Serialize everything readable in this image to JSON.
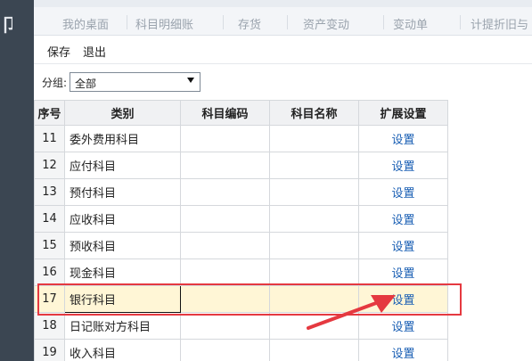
{
  "sidebar": {
    "glyph": "卩"
  },
  "tabs": [
    "我的桌面",
    "科目明细账",
    "存货",
    "资产变动",
    "变动单",
    "计提折旧与"
  ],
  "toolbar": {
    "save": "保存",
    "exit": "退出"
  },
  "filter": {
    "label": "分组:",
    "selected": "全部"
  },
  "table": {
    "headers": [
      "序号",
      "类别",
      "科目编码",
      "科目名称",
      "扩展设置"
    ],
    "rows": [
      {
        "idx": "11",
        "category": "委外费用科目",
        "code": "",
        "name": "",
        "action": "设置"
      },
      {
        "idx": "12",
        "category": "应付科目",
        "code": "",
        "name": "",
        "action": "设置"
      },
      {
        "idx": "13",
        "category": "预付科目",
        "code": "",
        "name": "",
        "action": "设置"
      },
      {
        "idx": "14",
        "category": "应收科目",
        "code": "",
        "name": "",
        "action": "设置"
      },
      {
        "idx": "15",
        "category": "预收科目",
        "code": "",
        "name": "",
        "action": "设置"
      },
      {
        "idx": "16",
        "category": "现金科目",
        "code": "",
        "name": "",
        "action": "设置"
      },
      {
        "idx": "17",
        "category": "银行科目",
        "code": "",
        "name": "",
        "action": "设置"
      },
      {
        "idx": "18",
        "category": "日记账对方科目",
        "code": "",
        "name": "",
        "action": "设置"
      },
      {
        "idx": "19",
        "category": "收入科目",
        "code": "",
        "name": "",
        "action": "设置"
      }
    ],
    "selected_row": "17"
  },
  "annotation": {
    "box_color": "#e53940",
    "arrow_color": "#e53940"
  }
}
